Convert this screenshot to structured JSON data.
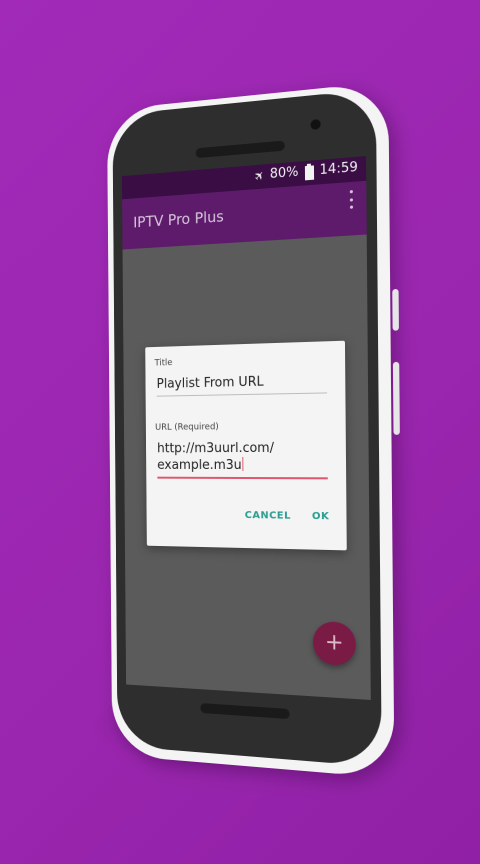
{
  "status_bar": {
    "airplane_icon": "airplane-icon",
    "battery_percent": "80%",
    "battery_icon": "battery-icon",
    "time": "14:59"
  },
  "app_bar": {
    "title": "IPTV Pro Plus",
    "overflow_icon": "more-vertical-icon"
  },
  "dialog": {
    "title_label": "Title",
    "title_value": "Playlist From URL",
    "url_label": "URL (Required)",
    "url_value_line1": "http://m3uurl.com/",
    "url_value_line2": "example.m3u",
    "cancel_label": "CANCEL",
    "ok_label": "OK"
  },
  "fab": {
    "label": "+",
    "icon": "plus-icon"
  },
  "colors": {
    "background": "#9c27b0",
    "status_bar": "#3a0d45",
    "app_bar": "#5e1b6c",
    "accent": "#2a9d90",
    "input_active": "#e0566e",
    "fab": "#7a1b46"
  }
}
